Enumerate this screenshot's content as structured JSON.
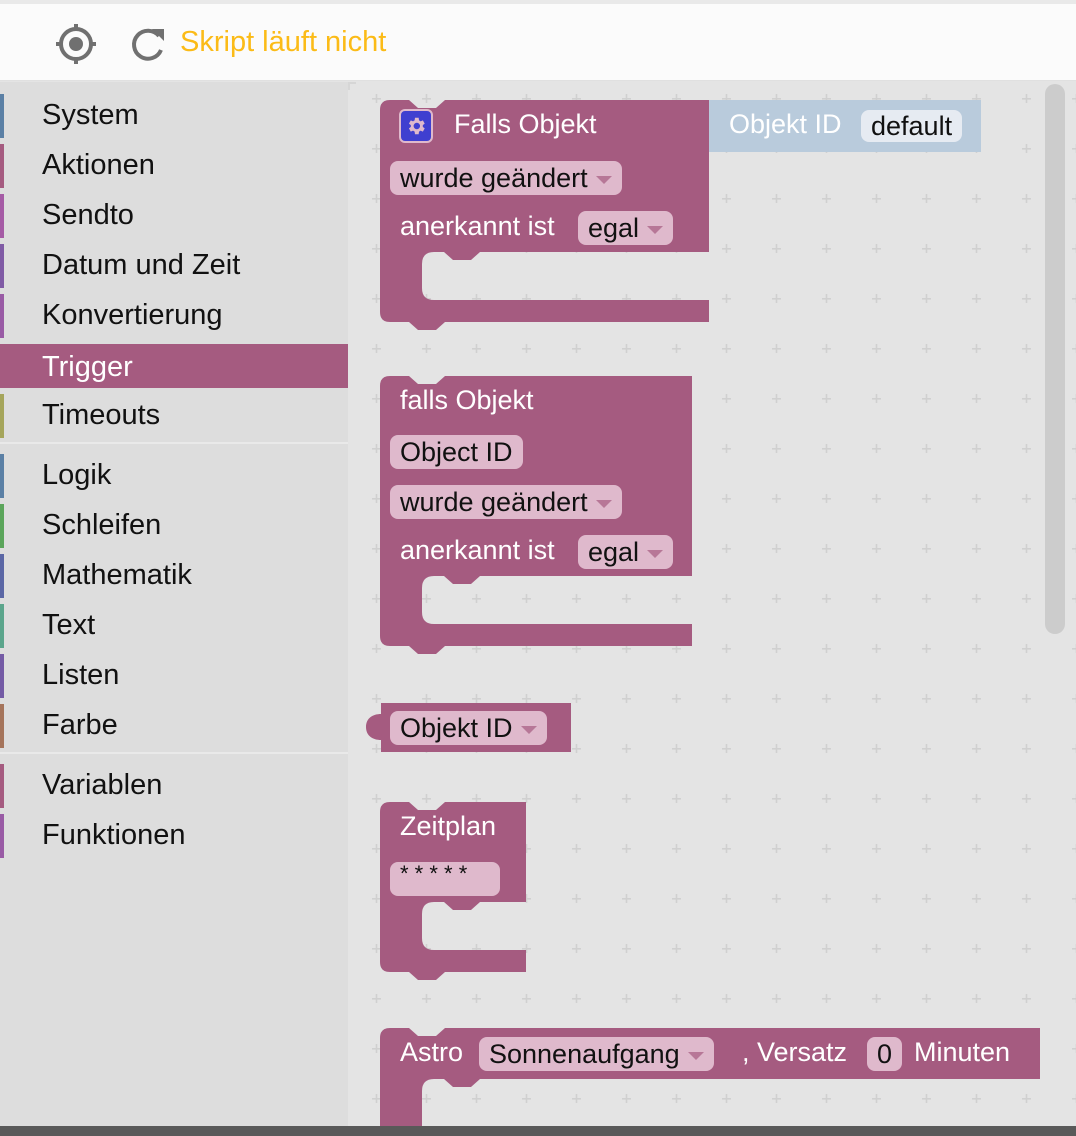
{
  "toolbar": {
    "locate_icon": "crosshair-icon",
    "refresh_icon": "refresh-icon",
    "status_text": "Skript läuft nicht",
    "status_color": "#fbbb17"
  },
  "sidebar": {
    "groups": [
      [
        {
          "label": "System",
          "color": "#5b80a5"
        },
        {
          "label": "Aktionen",
          "color": "#a55b80"
        },
        {
          "label": "Sendto",
          "color": "#a55ba5"
        },
        {
          "label": "Datum und Zeit",
          "color": "#805ba5"
        },
        {
          "label": "Konvertierung",
          "color": "#995ba5"
        },
        {
          "label": "Trigger",
          "color": "#a55b80",
          "selected": true
        },
        {
          "label": "Timeouts",
          "color": "#a5a55b"
        }
      ],
      [
        {
          "label": "Logik",
          "color": "#5b80a5"
        },
        {
          "label": "Schleifen",
          "color": "#5ba55b"
        },
        {
          "label": "Mathematik",
          "color": "#5b67a5"
        },
        {
          "label": "Text",
          "color": "#5ba58c"
        },
        {
          "label": "Listen",
          "color": "#745ba5"
        },
        {
          "label": "Farbe",
          "color": "#a5745b"
        }
      ],
      [
        {
          "label": "Variablen",
          "color": "#a55b80"
        },
        {
          "label": "Funktionen",
          "color": "#995ba5"
        }
      ]
    ]
  },
  "blocks": {
    "color": "#a55b80",
    "falls_objekt": {
      "gear_icon": "gear-icon",
      "title": "Falls Objekt",
      "event_dropdown": "wurde geändert",
      "ack_label": "anerkannt ist",
      "ack_dropdown": "egal",
      "objekt_id_block": {
        "label": "Objekt ID",
        "value": "default",
        "color": "#b9cbdc"
      }
    },
    "falls_objekt_2": {
      "title": "falls Objekt",
      "object_field": "Object ID",
      "event_dropdown": "wurde geändert",
      "ack_label": "anerkannt ist",
      "ack_dropdown": "egal"
    },
    "objekt_id": {
      "dropdown": "Objekt ID"
    },
    "zeitplan": {
      "title": "Zeitplan",
      "cron_field": "* * * * *"
    },
    "astro": {
      "title": "Astro",
      "event_dropdown": "Sonnenaufgang",
      "offset_label": ", Versatz",
      "offset_value": "0",
      "unit_label": "Minuten"
    }
  }
}
